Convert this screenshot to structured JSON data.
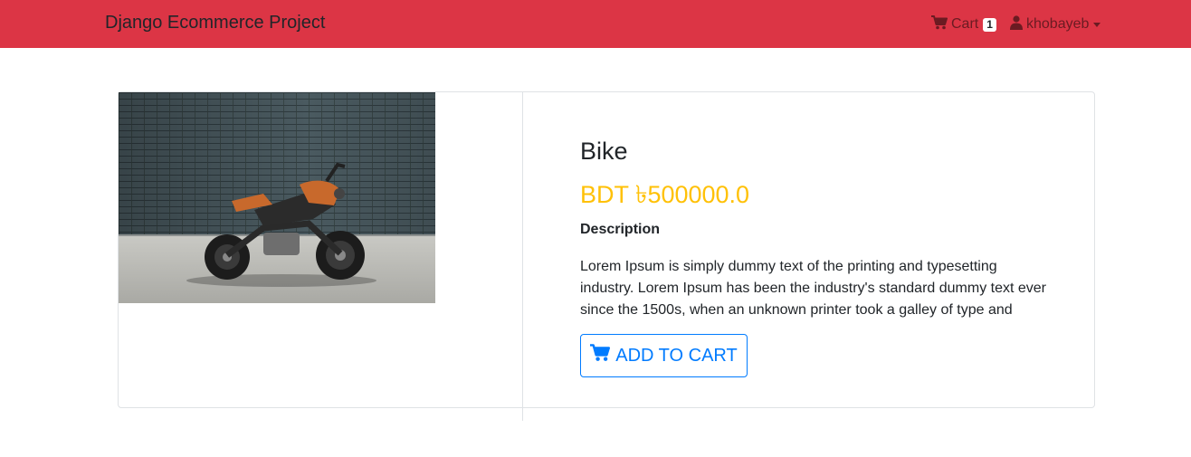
{
  "navbar": {
    "brand": "Django Ecommerce Project",
    "cart_label": "Cart",
    "cart_count": "1",
    "user_name": "khobayeb",
    "background": "#dc3545"
  },
  "product": {
    "title": "Bike",
    "price": "BDT ৳500000.0",
    "description_heading": "Description",
    "description": "Lorem Ipsum is simply dummy text of the printing and typesetting industry. Lorem Ipsum has been the industry's standard dummy text ever since the 1500s, when an unknown printer took a galley of type and",
    "add_to_cart_label": "ADD TO CART",
    "price_color": "#ffc107",
    "button_color": "#007bff"
  },
  "icons": {
    "cart": "cart-icon",
    "user": "user-icon",
    "dropdown": "caret-down-icon"
  }
}
